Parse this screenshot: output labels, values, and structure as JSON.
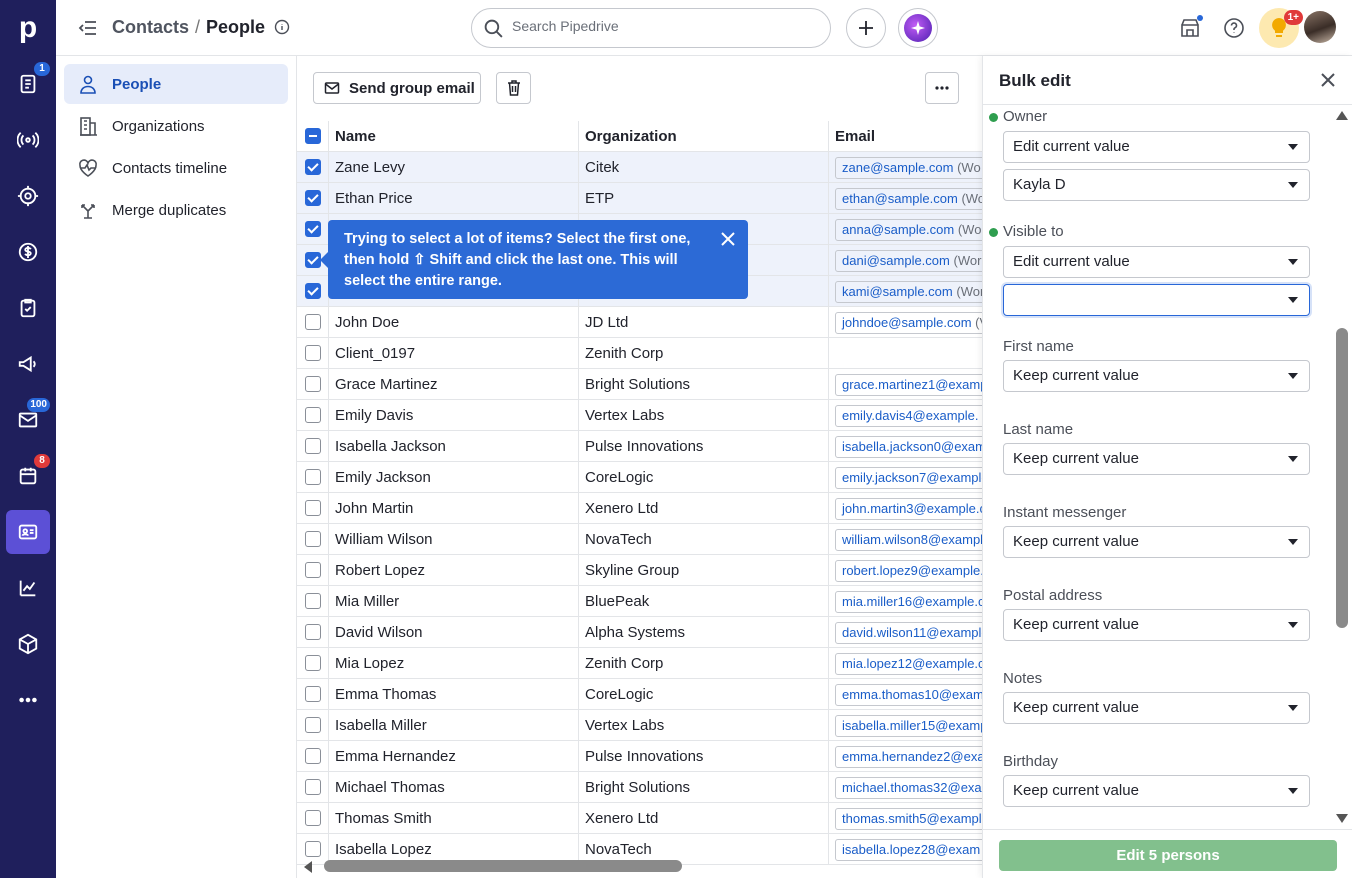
{
  "app": {
    "logo": "p"
  },
  "rail": {
    "items": [
      {
        "icon": "activities-icon",
        "badge": "1",
        "badge_color": "#2867d8"
      },
      {
        "icon": "leads-icon"
      },
      {
        "icon": "target-icon"
      },
      {
        "icon": "deals-icon"
      },
      {
        "icon": "tasks-icon"
      },
      {
        "icon": "campaigns-icon"
      },
      {
        "icon": "mail-icon",
        "badge": "100",
        "badge_color": "#2867d8"
      },
      {
        "icon": "calendar-icon",
        "badge": "8",
        "badge_color": "#e03a3a"
      },
      {
        "icon": "contacts-icon",
        "active": true
      },
      {
        "icon": "insights-icon"
      },
      {
        "icon": "products-icon"
      },
      {
        "icon": "more-icon"
      }
    ]
  },
  "header": {
    "crumb_parent": "Contacts",
    "crumb_sep": "/",
    "crumb_current": "People",
    "search_placeholder": "Search Pipedrive",
    "notif_badge": "1+"
  },
  "sidenav": {
    "items": [
      {
        "label": "People",
        "icon": "person-icon",
        "active": true
      },
      {
        "label": "Organizations",
        "icon": "building-icon"
      },
      {
        "label": "Contacts timeline",
        "icon": "heart-pulse-icon"
      },
      {
        "label": "Merge duplicates",
        "icon": "merge-icon"
      }
    ]
  },
  "toolbar": {
    "send_group_email": "Send group email"
  },
  "table": {
    "columns": [
      "Name",
      "Organization",
      "Email"
    ],
    "rows": [
      {
        "name": "Zane Levy",
        "org": "Citek",
        "email": "zane@sample.com",
        "label": "(Wo",
        "selected": true
      },
      {
        "name": "Ethan Price",
        "org": "ETP",
        "email": "ethan@sample.com",
        "label": "(Wo",
        "selected": true
      },
      {
        "name": "",
        "org": "",
        "email": "anna@sample.com",
        "label": "(Wo",
        "selected": true
      },
      {
        "name": "",
        "org": "",
        "email": "dani@sample.com",
        "label": "(Wor",
        "selected": true
      },
      {
        "name": "",
        "org": "",
        "email": "kami@sample.com",
        "label": "(Wor",
        "selected": true
      },
      {
        "name": "John Doe",
        "org": "JD Ltd",
        "email": "johndoe@sample.com",
        "label": "(V",
        "selected": false
      },
      {
        "name": "Client_0197",
        "org": "Zenith Corp",
        "email": "",
        "label": "",
        "selected": false
      },
      {
        "name": "Grace Martinez",
        "org": "Bright Solutions",
        "email": "grace.martinez1@examp",
        "label": "",
        "selected": false
      },
      {
        "name": "Emily Davis",
        "org": "Vertex Labs",
        "email": "emily.davis4@example.",
        "label": "",
        "selected": false
      },
      {
        "name": "Isabella Jackson",
        "org": "Pulse Innovations",
        "email": "isabella.jackson0@exam",
        "label": "",
        "selected": false
      },
      {
        "name": "Emily Jackson",
        "org": "CoreLogic",
        "email": "emily.jackson7@example",
        "label": "",
        "selected": false
      },
      {
        "name": "John Martin",
        "org": "Xenero Ltd",
        "email": "john.martin3@example.c",
        "label": "",
        "selected": false
      },
      {
        "name": "William Wilson",
        "org": "NovaTech",
        "email": "william.wilson8@exampl",
        "label": "",
        "selected": false
      },
      {
        "name": "Robert Lopez",
        "org": "Skyline Group",
        "email": "robert.lopez9@example.",
        "label": "",
        "selected": false
      },
      {
        "name": "Mia Miller",
        "org": "BluePeak",
        "email": "mia.miller16@example.c",
        "label": "",
        "selected": false
      },
      {
        "name": "David Wilson",
        "org": "Alpha Systems",
        "email": "david.wilson11@example",
        "label": "",
        "selected": false
      },
      {
        "name": "Mia Lopez",
        "org": "Zenith Corp",
        "email": "mia.lopez12@example.c",
        "label": "",
        "selected": false
      },
      {
        "name": "Emma Thomas",
        "org": "CoreLogic",
        "email": "emma.thomas10@examp",
        "label": "",
        "selected": false
      },
      {
        "name": "Isabella Miller",
        "org": "Vertex Labs",
        "email": "isabella.miller15@examp",
        "label": "",
        "selected": false
      },
      {
        "name": "Emma Hernandez",
        "org": "Pulse Innovations",
        "email": "emma.hernandez2@exa",
        "label": "",
        "selected": false
      },
      {
        "name": "Michael Thomas",
        "org": "Bright Solutions",
        "email": "michael.thomas32@exa",
        "label": "",
        "selected": false
      },
      {
        "name": "Thomas Smith",
        "org": "Xenero Ltd",
        "email": "thomas.smith5@exampl",
        "label": "",
        "selected": false
      },
      {
        "name": "Isabella Lopez",
        "org": "NovaTech",
        "email": "isabella.lopez28@exam",
        "label": "",
        "selected": false
      }
    ]
  },
  "tooltip": {
    "text": "Trying to select a lot of items? Select the first one, then hold ⇧ Shift and click the last one. This will select the entire range."
  },
  "bulk_edit": {
    "title": "Bulk edit",
    "owner_label": "Owner",
    "owner_mode": "Edit current value",
    "owner_value": "Kayla D",
    "visible_label": "Visible to",
    "visible_mode": "Edit current value",
    "visible_value": "",
    "fields": [
      {
        "label": "First name",
        "value": "Keep current value"
      },
      {
        "label": "Last name",
        "value": "Keep current value"
      },
      {
        "label": "Instant messenger",
        "value": "Keep current value"
      },
      {
        "label": "Postal address",
        "value": "Keep current value"
      },
      {
        "label": "Notes",
        "value": "Keep current value"
      },
      {
        "label": "Birthday",
        "value": "Keep current value"
      }
    ],
    "submit": "Edit 5 persons",
    "submit_color": "#82c08d"
  }
}
